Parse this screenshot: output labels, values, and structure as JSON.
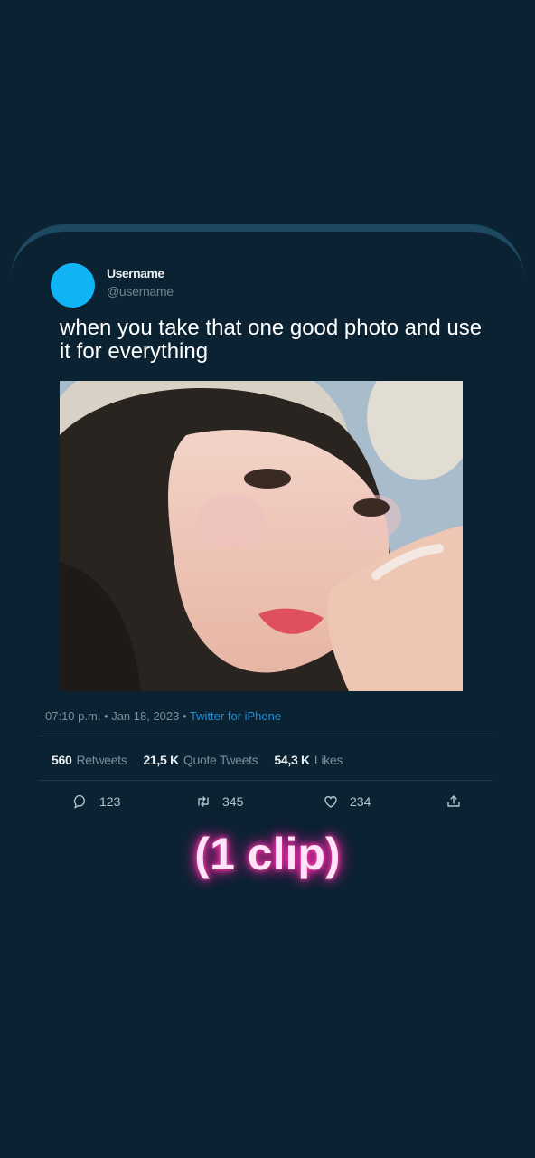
{
  "tweet": {
    "display_name": "Username",
    "handle": "@username",
    "text": "when you take that one good photo and use it for everything",
    "photo_alt": "portrait photo",
    "timestamp": "07:10 p.m. • Jan 18, 2023 •",
    "source": "Twitter for iPhone"
  },
  "stats": {
    "retweets_count": "560",
    "retweets_label": "Retweets",
    "quotes_count": "21,5 K",
    "quotes_label": "Quote Tweets",
    "likes_count": "54,3 K",
    "likes_label": "Likes"
  },
  "actions": {
    "reply_count": "123",
    "retweet_count": "345",
    "like_count": "234",
    "icons": [
      "reply-icon",
      "retweet-icon",
      "like-icon",
      "share-icon"
    ]
  },
  "overlay": {
    "label": "(1 clip)",
    "glow_color": "#ff2aa8"
  },
  "colors": {
    "background": "#0a2231",
    "avatar": "#10b4f5",
    "link": "#1d8fd6"
  }
}
